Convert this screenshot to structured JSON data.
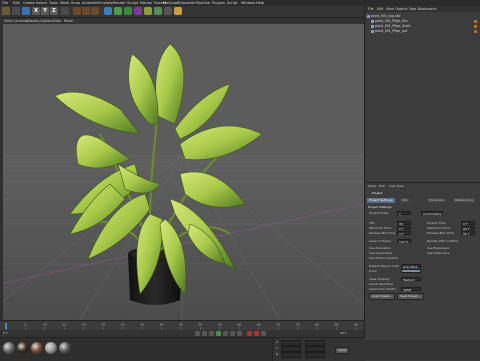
{
  "menubar": {
    "items": [
      "File",
      "Edit",
      "Create",
      "Select",
      "Tools",
      "Mesh",
      "Snap",
      "Animate",
      "Simulate",
      "Render",
      "Sculpt",
      "Motion Tracker",
      "MoGraph",
      "Character",
      "Pipeline",
      "Plugins",
      "Script",
      "Window",
      "Help"
    ]
  },
  "toolbar": {
    "axis_x": "X",
    "axis_y": "Y",
    "axis_z": "Z"
  },
  "viewport_menu": {
    "items": [
      "View",
      "Cameras",
      "Display",
      "Options",
      "Filter",
      "Panel"
    ]
  },
  "object_manager": {
    "menu": [
      "File",
      "Edit",
      "View",
      "Objects",
      "Tags",
      "Bookmarks"
    ],
    "objects": [
      {
        "name": "plant_001_top.c4d"
      },
      {
        "name": "plant_001_Pflge_Sku"
      },
      {
        "name": "plant_001_Pflge_GodX"
      },
      {
        "name": "plant_001_Pflge_pot"
      }
    ]
  },
  "attributes": {
    "menu": [
      "Mode",
      "Edit",
      "User Data"
    ],
    "title": "Project",
    "tabs": [
      "Project Settings",
      "Info",
      "Dynamics",
      "Referencing"
    ],
    "section": "Project Settings",
    "rows_left": [
      {
        "label": "Project Scale",
        "value": "1"
      },
      {
        "label": "FPS",
        "value": "30"
      },
      {
        "label": "Minimum Time",
        "value": "0 F"
      },
      {
        "label": "Preview Min Time",
        "value": "0 F"
      },
      {
        "label": "Level of Detail",
        "value": "100 %"
      },
      {
        "label": "Use Animation",
        "value": ""
      },
      {
        "label": "Use Generators",
        "value": ""
      },
      {
        "label": "Use Motion System",
        "value": ""
      },
      {
        "label": "Default Object Color",
        "value": "Gray-Blue"
      },
      {
        "label": "Color",
        "value": ""
      },
      {
        "label": "View Clipping",
        "value": "Medium"
      },
      {
        "label": "Linear Workflow",
        "value": ""
      },
      {
        "label": "Input Color Profile",
        "value": "sRGB"
      }
    ],
    "rows_right": [
      {
        "label": "Centimeters",
        "value": ""
      },
      {
        "label": "Project Time",
        "value": "0 F"
      },
      {
        "label": "Maximum Time",
        "value": "90 F"
      },
      {
        "label": "Preview Max Time",
        "value": "90 F"
      },
      {
        "label": "Render LOD in Editor",
        "value": ""
      },
      {
        "label": "Use Expression",
        "value": ""
      },
      {
        "label": "Use Deformers",
        "value": ""
      }
    ],
    "buttons": [
      "Load Preset...",
      "Save Preset..."
    ]
  },
  "timeline": {
    "ticks": [
      "0",
      "5",
      "10",
      "15",
      "20",
      "25",
      "30",
      "35",
      "40",
      "45",
      "50",
      "55",
      "60",
      "65",
      "70",
      "75",
      "80",
      "85",
      "90"
    ],
    "start_frame": "0 F",
    "end_frame": "90 F"
  },
  "coordinates": {
    "rows": [
      "X",
      "Y",
      "Z"
    ],
    "apply": "Apply"
  },
  "materials": {
    "colors": [
      "#6a6a6a",
      "#3d2a1a",
      "#7a4a3a",
      "#9a9a9a",
      "#5a5a5a"
    ]
  }
}
